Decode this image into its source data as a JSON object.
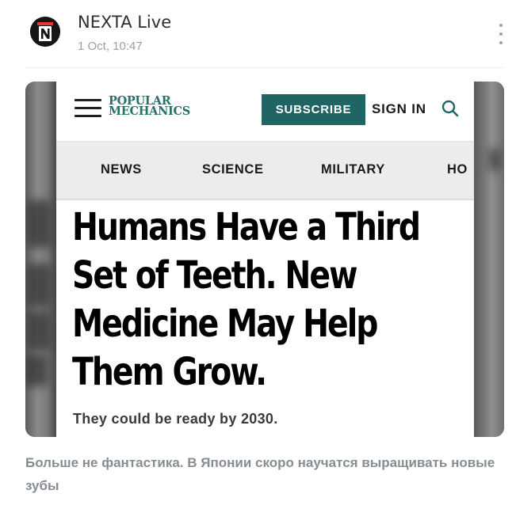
{
  "post": {
    "channel_name": "NEXTA Live",
    "time": "1 Oct, 10:47",
    "avatar_icon": "nexta-logo-icon",
    "menu_icon": "more-vertical-icon",
    "caption": "Больше не фантастика. В Японии скоро научатся выращивать новые зубы"
  },
  "article": {
    "site": {
      "logo_line1": "POPULAR",
      "logo_line2": "MECHANICS",
      "subscribe_label": "SUBSCRIBE",
      "signin_label": "SIGN IN",
      "accent_color": "#1f6563"
    },
    "nav": {
      "items": [
        "NEWS",
        "SCIENCE",
        "MILITARY",
        "HO"
      ]
    },
    "headline_lines": [
      "Humans Have a Third",
      "Set of Teeth. New",
      "Medicine May Help",
      "Them Grow."
    ],
    "subhead": "They could be ready by 2030."
  }
}
